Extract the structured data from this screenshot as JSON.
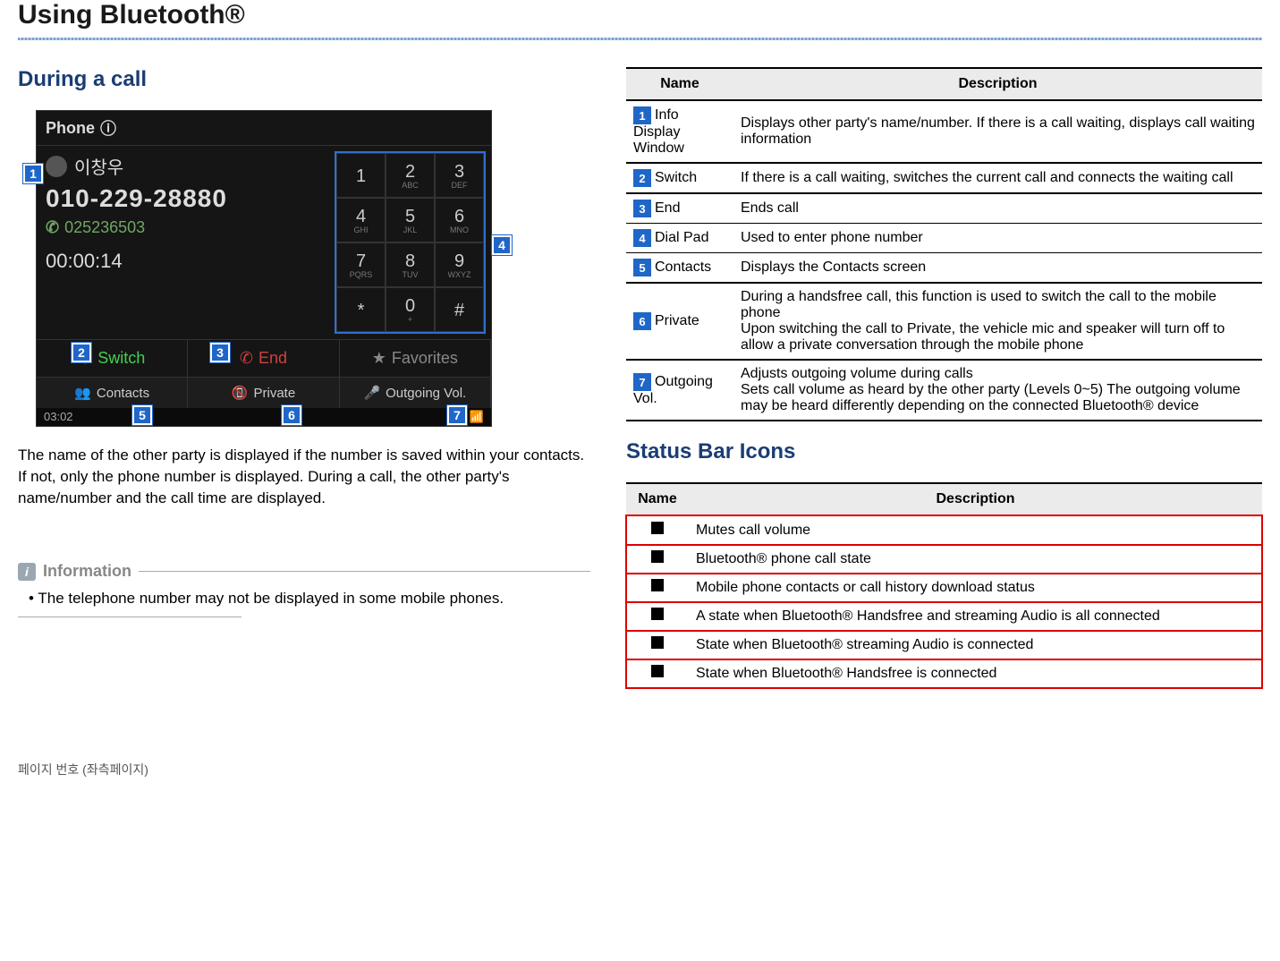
{
  "page": {
    "title": "Using Bluetooth®",
    "footer": "페이지 번호 (좌측페이지)"
  },
  "left": {
    "heading": "During a call",
    "phone": {
      "header": "Phone",
      "contact_name": "이창우",
      "phone_number": "010-229-28880",
      "sub_number": "025236503",
      "timer": "00:00:14",
      "keys": [
        {
          "d": "1",
          "s": ""
        },
        {
          "d": "2",
          "s": "ABC"
        },
        {
          "d": "3",
          "s": "DEF"
        },
        {
          "d": "4",
          "s": "GHI"
        },
        {
          "d": "5",
          "s": "JKL"
        },
        {
          "d": "6",
          "s": "MNO"
        },
        {
          "d": "7",
          "s": "PQRS"
        },
        {
          "d": "8",
          "s": "TUV"
        },
        {
          "d": "9",
          "s": "WXYZ"
        },
        {
          "d": "*",
          "s": ""
        },
        {
          "d": "0",
          "s": "+"
        },
        {
          "d": "#",
          "s": ""
        }
      ],
      "switch_label": "Switch",
      "end_label": "End",
      "favorite_label": "Favorites",
      "contacts_label": "Contacts",
      "private_label": "Private",
      "outgoing_label": "Outgoing Vol.",
      "clock": "03:02"
    },
    "callouts": {
      "c1": "1",
      "c2": "2",
      "c3": "3",
      "c4": "4",
      "c5": "5",
      "c6": "6",
      "c7": "7"
    },
    "body_text": "The name of the other party is displayed if the number is saved within your contacts. If not, only the phone number is displayed. During a call, the other party's name/number and the call time are displayed.",
    "info_title": "Information",
    "info_bullet": "• The telephone number may not be displayed in some mobile phones."
  },
  "right": {
    "desc_header_name": "Name",
    "desc_header_desc": "Description",
    "rows": [
      {
        "n": "1",
        "name": "Info Display Window",
        "desc": "Displays other party's name/number. If there is a call waiting, displays call waiting information"
      },
      {
        "n": "2",
        "name": "Switch",
        "desc": "If there is a call waiting, switches the current call and connects the waiting call"
      },
      {
        "n": "3",
        "name": "End",
        "desc": "Ends call"
      },
      {
        "n": "4",
        "name": "Dial Pad",
        "desc": "Used to enter phone number"
      },
      {
        "n": "5",
        "name": "Contacts",
        "desc": "Displays the Contacts screen"
      },
      {
        "n": "6",
        "name": "Private",
        "desc": "During a handsfree call, this function is used to switch the call to the mobile phone\nUpon switching the call to Private, the vehicle mic and speaker will turn off to allow a private conversation through the mobile phone"
      },
      {
        "n": "7",
        "name": "Outgoing Vol.",
        "desc": "Adjusts outgoing volume during calls\nSets call volume as heard by the other party (Levels 0~5) The outgoing volume may be heard differently depending on the connected Bluetooth® device"
      }
    ],
    "status_heading": "Status Bar Icons",
    "status_rows": [
      {
        "desc": "Mutes call volume"
      },
      {
        "desc": "Bluetooth® phone call state"
      },
      {
        "desc": "Mobile phone contacts or call history download status"
      },
      {
        "desc": "A state when Bluetooth® Handsfree and streaming Audio is all connected"
      },
      {
        "desc": "State when Bluetooth® streaming Audio is connected"
      },
      {
        "desc": "State when Bluetooth® Handsfree is connected"
      }
    ]
  }
}
